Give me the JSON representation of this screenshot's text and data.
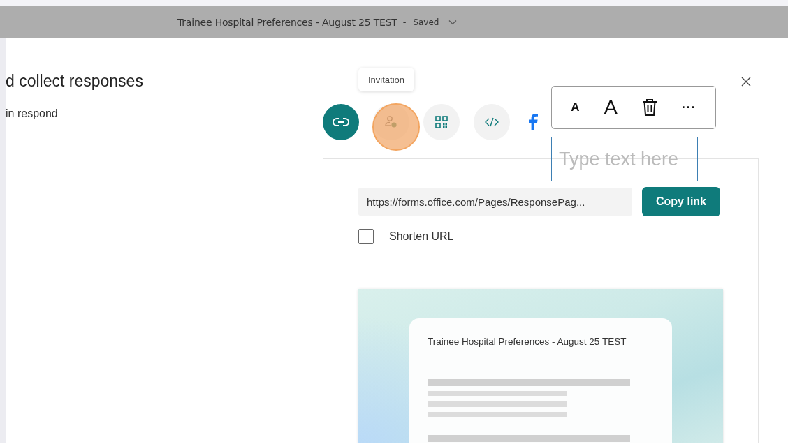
{
  "header": {
    "title": "Trainee Hospital Preferences - August 25 TEST",
    "separator": "-",
    "status": "Saved"
  },
  "dialog": {
    "heading": "d collect responses",
    "subtext": "in respond"
  },
  "tooltip": "Invitation",
  "share_options": [
    {
      "kind": "link",
      "selected": true
    },
    {
      "kind": "invite",
      "selected": false
    },
    {
      "kind": "qr",
      "selected": false
    },
    {
      "kind": "embed",
      "selected": false
    },
    {
      "kind": "facebook",
      "selected": false
    }
  ],
  "link": {
    "url": "https://forms.office.com/Pages/ResponsePag...",
    "copy_button": "Copy link",
    "shorten_label": "Shorten URL",
    "shorten_checked": false
  },
  "preview": {
    "form_title": "Trainee Hospital Preferences - August 25 TEST"
  },
  "annotation_toolbar": [
    {
      "kind": "small_text",
      "label": "A"
    },
    {
      "kind": "large_text",
      "label": "A"
    },
    {
      "kind": "delete"
    },
    {
      "kind": "more",
      "label": "···"
    }
  ],
  "text_box": {
    "placeholder": "Type text here"
  }
}
